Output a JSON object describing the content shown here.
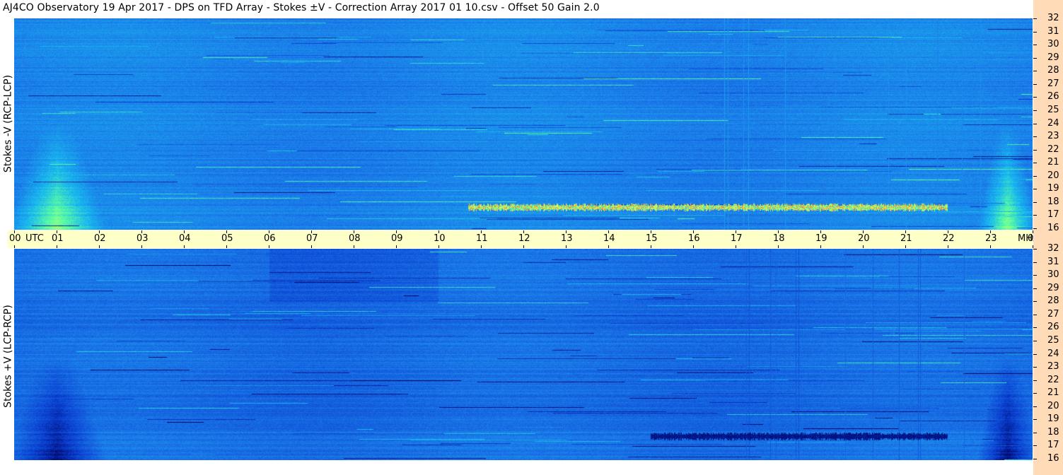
{
  "title": "AJ4CO Observatory  19 Apr 2017  -  DPS on TFD Array  -  Stokes ±V  -  Correction Array 2017 01 10.csv  -  Offset 50  Gain 2.0",
  "chart_data": [
    {
      "type": "heatmap",
      "panel": "top",
      "ylabel": "Stokes -V (RCP-LCP)",
      "x_ticks": [
        "00",
        "01",
        "02",
        "03",
        "04",
        "05",
        "06",
        "07",
        "08",
        "09",
        "10",
        "11",
        "12",
        "13",
        "14",
        "15",
        "16",
        "17",
        "18",
        "19",
        "20",
        "21",
        "22",
        "23",
        "00"
      ],
      "x_unit": "UTC",
      "x_range": [
        0,
        24
      ],
      "y_ticks": [
        "16",
        "17",
        "18",
        "19",
        "20",
        "21",
        "22",
        "23",
        "24",
        "25",
        "26",
        "27",
        "28",
        "29",
        "30",
        "31",
        "32"
      ],
      "y_unit": "MHz",
      "y_range": [
        16,
        32
      ],
      "grid": false,
      "colormap": [
        "#000060",
        "#0a3fd0",
        "#1b78e8",
        "#18b8f0",
        "#5cffa0",
        "#ffff40",
        "#ff6020"
      ],
      "features": [
        {
          "kind": "band",
          "t_start": 10.7,
          "t_end": 22.0,
          "f": 17.7,
          "polarity": "positive"
        },
        {
          "kind": "glow",
          "t_start": 0.0,
          "t_end": 2.0,
          "f_start": 16.0,
          "f_end": 24.0,
          "polarity": "positive"
        },
        {
          "kind": "glow",
          "t_start": 22.8,
          "t_end": 24.0,
          "f_start": 16.0,
          "f_end": 24.0,
          "polarity": "positive"
        }
      ]
    },
    {
      "type": "heatmap",
      "panel": "bottom",
      "ylabel": "Stokes +V (LCP-RCP)",
      "x_ticks": [
        "00",
        "01",
        "02",
        "03",
        "04",
        "05",
        "06",
        "07",
        "08",
        "09",
        "10",
        "11",
        "12",
        "13",
        "14",
        "15",
        "16",
        "17",
        "18",
        "19",
        "20",
        "21",
        "22",
        "23",
        "00"
      ],
      "x_unit": "UTC",
      "x_range": [
        0,
        24
      ],
      "y_ticks": [
        "16",
        "17",
        "18",
        "19",
        "20",
        "21",
        "22",
        "23",
        "24",
        "25",
        "26",
        "27",
        "28",
        "29",
        "30",
        "31",
        "32"
      ],
      "y_unit": "MHz",
      "y_range": [
        16,
        32
      ],
      "grid": false,
      "colormap": [
        "#000060",
        "#0a3fd0",
        "#1b78e8",
        "#18b8f0",
        "#5cffa0",
        "#ffff40",
        "#ff6020"
      ],
      "features": [
        {
          "kind": "band",
          "t_start": 15.0,
          "t_end": 22.0,
          "f": 17.8,
          "polarity": "negative"
        },
        {
          "kind": "glow",
          "t_start": 0.0,
          "t_end": 2.0,
          "f_start": 16.0,
          "f_end": 24.0,
          "polarity": "negative"
        },
        {
          "kind": "glow",
          "t_start": 22.8,
          "t_end": 24.0,
          "f_start": 16.0,
          "f_end": 24.0,
          "polarity": "negative"
        }
      ]
    }
  ]
}
